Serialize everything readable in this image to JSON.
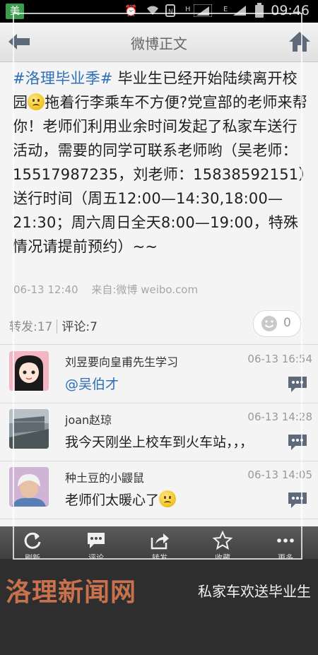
{
  "status_bar": {
    "app_badge": "美",
    "icons": [
      "alarm-icon",
      "wifi-icon",
      "nfc-icon",
      "signal-h-icon",
      "signal-e-icon",
      "battery-icon"
    ],
    "net_h": "H",
    "net_e": "E",
    "time": "09:46"
  },
  "header": {
    "title": "微博正文"
  },
  "post": {
    "topic": "#洛理毕业季#",
    "text_part1": " 毕业生已经开始陆续离开校园",
    "text_part2": "拖着行李乘车不方便?党宣部的老师来帮你！老师们利用业余时间发起了私家车送行活动，需要的同学可联系老师哟（吴老师：15517987235，刘老师：15838592151）送行时间（周五12:00—14:30,18:00—21:30；周六周日全天8:00—19:00，特殊情况请提前预约）~~",
    "time": "06-13 12:40",
    "source": "来自:微博 weibo.com"
  },
  "counts": {
    "repost": "转发:17",
    "comment": "评论:7",
    "likes": "0"
  },
  "comments": [
    {
      "name": "刘昱要向皇甫先生学习",
      "time": "06-13 16:54",
      "text": "@吴伯才"
    },
    {
      "name": "joan赵琼",
      "time": "06-13 14:28",
      "text": "我今天刚坐上校车到火车站，，，"
    },
    {
      "name": "种土豆的小鼹鼠",
      "time": "06-13 14:05",
      "text": "老师们太暖心了"
    }
  ],
  "toolbar": {
    "refresh": "刷新",
    "comment": "评论",
    "repost": "转发",
    "favorite": "收藏",
    "more": "更多"
  },
  "banner": {
    "logo": "洛理新闻网",
    "caption": "私家车欢送毕业生"
  },
  "colors": {
    "link": "#2e6fb8",
    "header_bg": "#ececec",
    "toolbar_bg": "#4a4a4a",
    "banner_bg": "#2e2e2e",
    "logo": "#c9714d"
  }
}
